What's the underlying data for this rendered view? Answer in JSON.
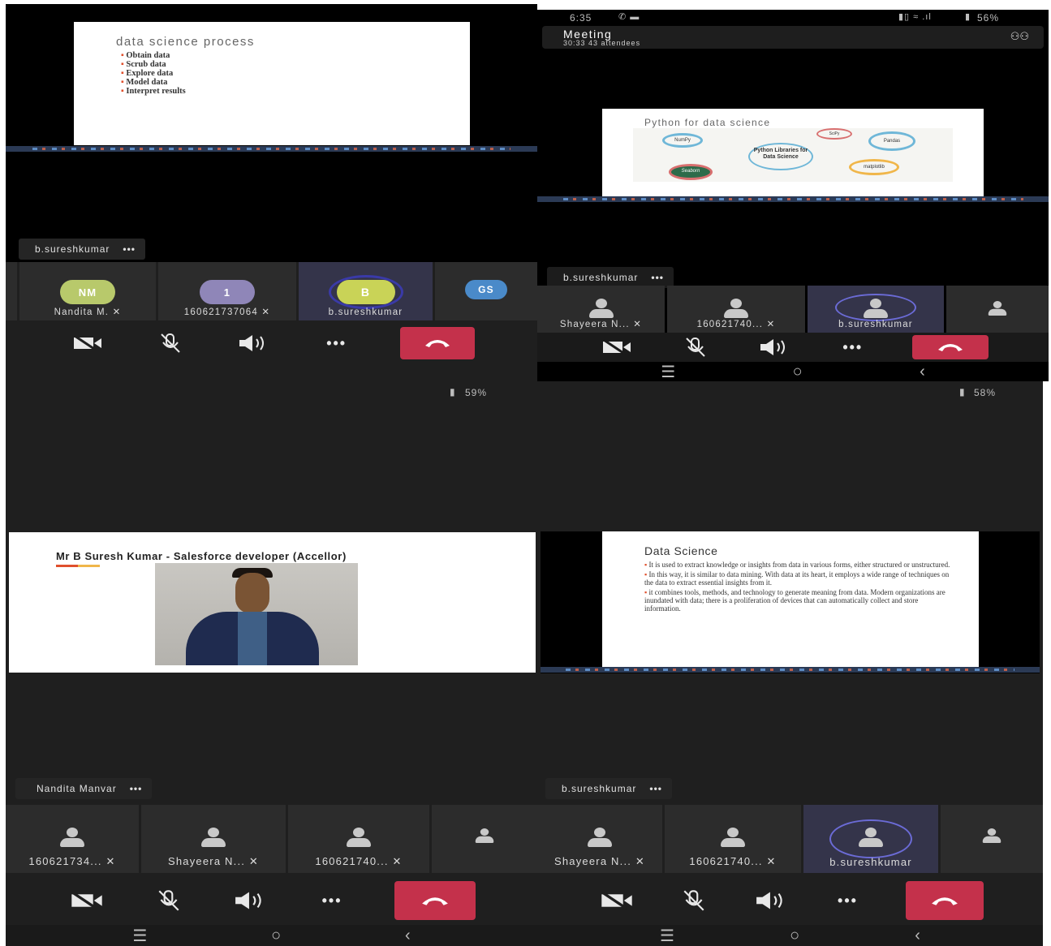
{
  "panel1": {
    "slide": {
      "title": "data science process",
      "bullets": [
        "Obtain data",
        "Scrub data",
        "Explore data",
        "Model data",
        "Interpret results"
      ]
    },
    "speaker": "b.sureshkumar",
    "participants": [
      {
        "initials": "NM",
        "name": "Nandita M.",
        "color": "#b8c96b"
      },
      {
        "initials": "1",
        "name": "160621737064",
        "color": "#8f86b8"
      },
      {
        "initials": "B",
        "name": "b.sureshkumar",
        "color": "#c9d357"
      },
      {
        "initials": "GS",
        "name": "",
        "color": "#4a8ac9"
      }
    ]
  },
  "panel2": {
    "status_time": "6:35",
    "status_battery": "56%",
    "meeting_title": "Meeting",
    "meeting_sub": "30:33   43 attendees",
    "slide": {
      "title": "Python for data science",
      "center_label": "Python Libraries for Data Science",
      "libs": [
        "Pandas",
        "matplotlib",
        "Seaborn",
        "NumPy",
        "SciPy"
      ]
    },
    "speaker": "b.sureshkumar",
    "participants": [
      "Shayeera N...",
      "160621740...",
      "b.sureshkumar"
    ]
  },
  "panel3": {
    "status_battery": "59%",
    "slide": {
      "title": "Mr B Suresh Kumar -  Salesforce developer (Accellor)"
    },
    "speaker": "Nandita Manvar",
    "participants": [
      "160621734...",
      "Shayeera N...",
      "160621740..."
    ]
  },
  "panel4": {
    "status_battery": "58%",
    "slide": {
      "title": "Data Science",
      "bullets": [
        "It is used to extract knowledge or insights from data in various forms, either structured or unstructured.",
        "In this way, it is similar to data mining. With data at its heart, it employs a wide range of techniques on the data to extract essential insights from it.",
        "it combines tools, methods, and technology to generate meaning from data. Modern organizations are inundated with data; there is a proliferation of devices that can automatically collect and store information."
      ]
    },
    "speaker": "b.sureshkumar",
    "participants": [
      "Shayeera N...",
      "160621740...",
      "b.sureshkumar"
    ]
  },
  "colors": {
    "hangup": "#c4314b",
    "bullet": "#e0502d",
    "accent_ring": "#6b6bd6"
  },
  "icons": {
    "more": "...",
    "hangup": "phone-hangup-icon",
    "camera": "camera-off-icon",
    "mic": "mic-off-icon",
    "speaker": "speaker-icon",
    "more_name": "more-options-icon"
  }
}
